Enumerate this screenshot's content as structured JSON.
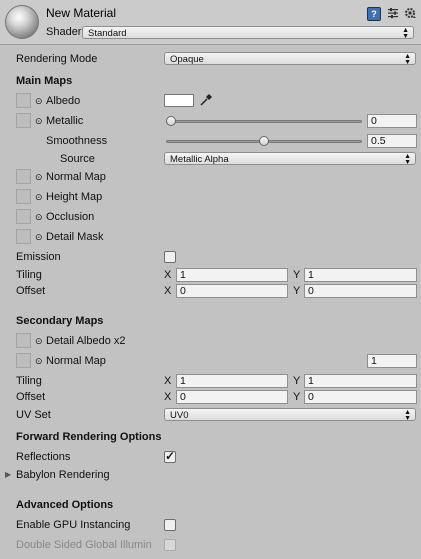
{
  "header": {
    "title": "New Material",
    "shader_label": "Shader",
    "shader_value": "Standard"
  },
  "rendering_mode": {
    "label": "Rendering Mode",
    "value": "Opaque"
  },
  "main_maps": {
    "heading": "Main Maps",
    "albedo_label": "Albedo",
    "metallic_label": "Metallic",
    "metallic_value": "0",
    "metallic_fraction": 0,
    "smoothness_label": "Smoothness",
    "smoothness_value": "0.5",
    "smoothness_fraction": 0.5,
    "source_label": "Source",
    "source_value": "Metallic Alpha",
    "normal_label": "Normal Map",
    "height_label": "Height Map",
    "occlusion_label": "Occlusion",
    "detail_mask_label": "Detail Mask",
    "emission_label": "Emission",
    "tiling_label": "Tiling",
    "tiling_x": "1",
    "tiling_y": "1",
    "offset_label": "Offset",
    "offset_x": "0",
    "offset_y": "0",
    "x_label": "X",
    "y_label": "Y"
  },
  "secondary_maps": {
    "heading": "Secondary Maps",
    "detail_albedo_label": "Detail Albedo x2",
    "normal_label": "Normal Map",
    "normal_value": "1",
    "tiling_label": "Tiling",
    "tiling_x": "1",
    "tiling_y": "1",
    "offset_label": "Offset",
    "offset_x": "0",
    "offset_y": "0",
    "uvset_label": "UV Set",
    "uvset_value": "UV0",
    "x_label": "X",
    "y_label": "Y"
  },
  "forward": {
    "heading": "Forward Rendering Options",
    "reflections_label": "Reflections",
    "reflections_checked": true,
    "babylon_label": "Babylon Rendering"
  },
  "advanced": {
    "heading": "Advanced Options",
    "gpu_label": "Enable GPU Instancing",
    "double_sided_label": "Double Sided Global Illumin"
  },
  "icons": {
    "check": "✓",
    "dropdown_arrow": "▲▼",
    "picker_dot": "⊙",
    "foldout": "▶"
  }
}
